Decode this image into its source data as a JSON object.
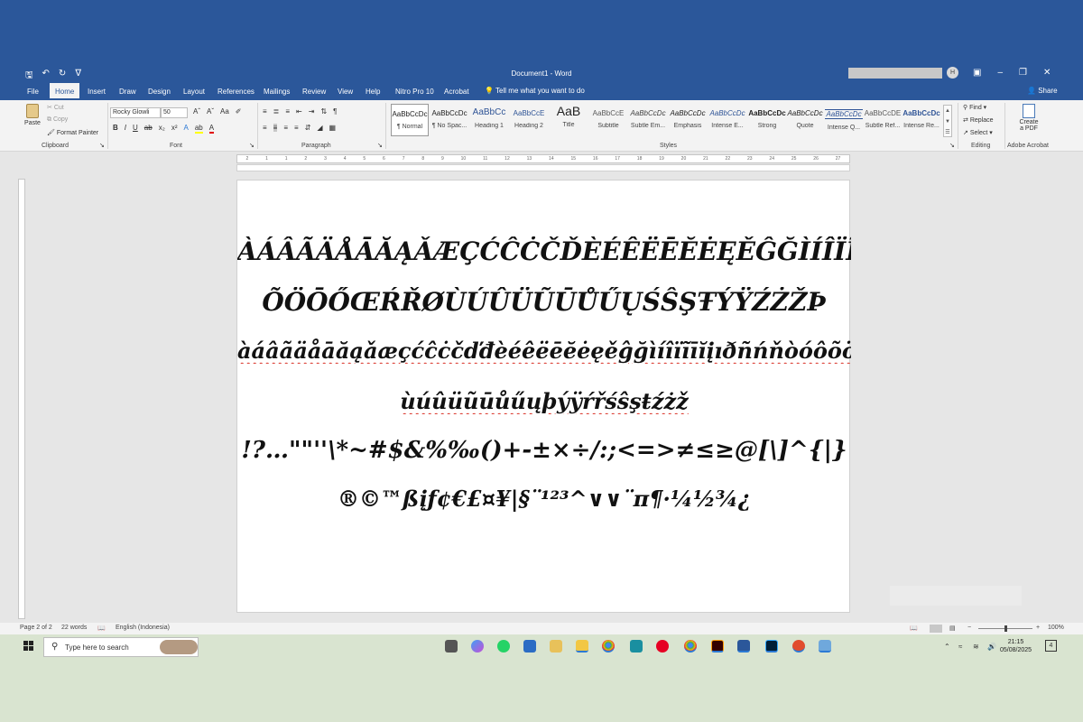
{
  "window": {
    "title": "Document1  -  Word",
    "avatar_initial": "H"
  },
  "tabs": [
    {
      "label": "File"
    },
    {
      "label": "Home",
      "active": true
    },
    {
      "label": "Insert"
    },
    {
      "label": "Draw"
    },
    {
      "label": "Design"
    },
    {
      "label": "Layout"
    },
    {
      "label": "References"
    },
    {
      "label": "Mailings"
    },
    {
      "label": "Review"
    },
    {
      "label": "View"
    },
    {
      "label": "Help"
    },
    {
      "label": "Nitro Pro 10"
    },
    {
      "label": "Acrobat"
    }
  ],
  "tell_me": "Tell me what you want to do",
  "share": "Share",
  "ribbon": {
    "clipboard": {
      "paste": "Paste",
      "cut": "Cut",
      "copy": "Copy",
      "format_painter": "Format Painter",
      "label": "Clipboard"
    },
    "font": {
      "font_name": "Rocky Glowli",
      "font_size": "50",
      "label": "Font"
    },
    "paragraph": {
      "label": "Paragraph"
    },
    "styles": {
      "label": "Styles",
      "items": [
        {
          "sample": "AaBbCcDc",
          "name": "¶ Normal"
        },
        {
          "sample": "AaBbCcDc",
          "name": "¶ No Spac..."
        },
        {
          "sample": "AaBbCc",
          "name": "Heading 1"
        },
        {
          "sample": "AaBbCcE",
          "name": "Heading 2"
        },
        {
          "sample": "AaB",
          "name": "Title"
        },
        {
          "sample": "AaBbCcE",
          "name": "Subtitle"
        },
        {
          "sample": "AaBbCcDc",
          "name": "Subtle Em..."
        },
        {
          "sample": "AaBbCcDc",
          "name": "Emphasis"
        },
        {
          "sample": "AaBbCcDc",
          "name": "Intense E..."
        },
        {
          "sample": "AaBbCcDc",
          "name": "Strong"
        },
        {
          "sample": "AaBbCcDc",
          "name": "Quote"
        },
        {
          "sample": "AaBbCcDc",
          "name": "Intense Q..."
        },
        {
          "sample": "AaBbCcDE",
          "name": "Subtle Ref..."
        },
        {
          "sample": "AaBbCcDc",
          "name": "Intense Re..."
        }
      ]
    },
    "editing": {
      "find": "Find",
      "replace": "Replace",
      "select": "Select",
      "label": "Editing"
    },
    "acrobat": {
      "create_pdf_line1": "Create",
      "create_pdf_line2": "a PDF",
      "label": "Adobe Acrobat"
    }
  },
  "ruler_ticks": [
    "2",
    "1",
    "1",
    "2",
    "3",
    "4",
    "5",
    "6",
    "7",
    "8",
    "9",
    "10",
    "11",
    "12",
    "13",
    "14",
    "15",
    "16",
    "17",
    "18",
    "19",
    "20",
    "21",
    "22",
    "23",
    "24",
    "25",
    "26",
    "27"
  ],
  "document": {
    "lines": [
      "ÀÁÂÃÄÅĀĂĄǍÆÇĆĈĊČĎÈÉÊËĒĔĖĘĚĜĞÌÍÎÏĨĪĬĮİĐÑŃŇÒÓÔ",
      "ÕÖŌŐŒŔŘØÙÚÛÜŨŪŮŰŲŚŜŞŦÝŸŹŻŽÞ",
      "àáâãäåāăąǎæçćĉċčďđèéêëēĕėęěĝğìíîïĩīĭįıðñńňòóôõöōőø",
      "ùúûüũūůűųþýÿŕřśŝşŧźżž",
      "!?…\"\"''\\*~#$&%‰()+-±×÷/:;<=>≠≤≥@[\\]^{|}",
      "®©™ßįƒ¢€£¤¥|§¨¹²³^∨∨¨π¶·¼½¾¿"
    ]
  },
  "status": {
    "page": "Page 2 of 2",
    "words": "22 words",
    "language": "English (Indonesia)",
    "zoom": "100%"
  },
  "taskbar": {
    "search_placeholder": "Type here to search",
    "time": "21:15",
    "date": "05/08/2025",
    "notifications": "4",
    "app_icons": [
      "task-view-icon",
      "copilot-icon",
      "whatsapp-icon",
      "store-icon",
      "paint-icon",
      "file-explorer-icon",
      "chrome-icon",
      "app-icon",
      "pinterest-icon",
      "chrome-profile-icon",
      "illustrator-icon",
      "word-icon",
      "photoshop-icon",
      "app-icon-2",
      "app-icon-3"
    ]
  }
}
